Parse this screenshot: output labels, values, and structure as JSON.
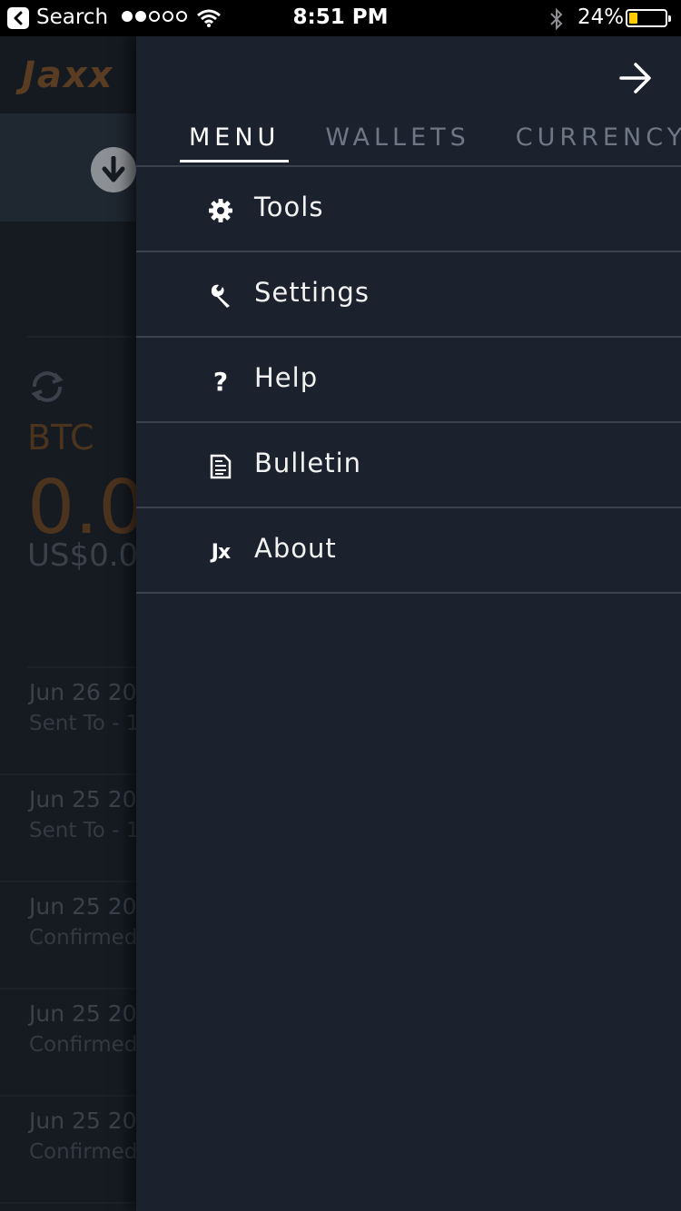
{
  "status_bar": {
    "back_label": "Search",
    "time": "8:51 PM",
    "battery_percent": "24%",
    "battery_level": 0.24,
    "signal_bars_filled": 2,
    "signal_bars_total": 5
  },
  "background_app": {
    "logo": "Jaxx",
    "coin": "BTC",
    "balance": "0.0(",
    "fiat_balance": "US$0.0",
    "transactions": [
      {
        "date": "Jun 26 20",
        "description": "Sent To - 1"
      },
      {
        "date": "Jun 25 20",
        "description": "Sent To - 1"
      },
      {
        "date": "Jun 25 20",
        "description": "Confirmed"
      },
      {
        "date": "Jun 25 20",
        "description": "Confirmed"
      },
      {
        "date": "Jun 25 20",
        "description": "Confirmed"
      }
    ]
  },
  "drawer": {
    "tabs": [
      {
        "label": "MENU",
        "active": true
      },
      {
        "label": "WALLETS",
        "active": false
      },
      {
        "label": "CURRENCY",
        "active": false
      }
    ],
    "menu_items": [
      {
        "label": "Tools",
        "icon": "gear-icon"
      },
      {
        "label": "Settings",
        "icon": "wrench-icon"
      },
      {
        "label": "Help",
        "icon": "question-icon"
      },
      {
        "label": "Bulletin",
        "icon": "document-icon"
      },
      {
        "label": "About",
        "icon": "jx-logo-icon",
        "icon_text": "Jx"
      }
    ]
  },
  "colors": {
    "drawer_bg": "#1c222d",
    "app_bg": "#161b22",
    "divider": "#3a414c",
    "active_tab": "#ffffff",
    "inactive_tab": "#6e7785",
    "brand_dim": "#4c331e",
    "battery_fill": "#ffcc00"
  }
}
